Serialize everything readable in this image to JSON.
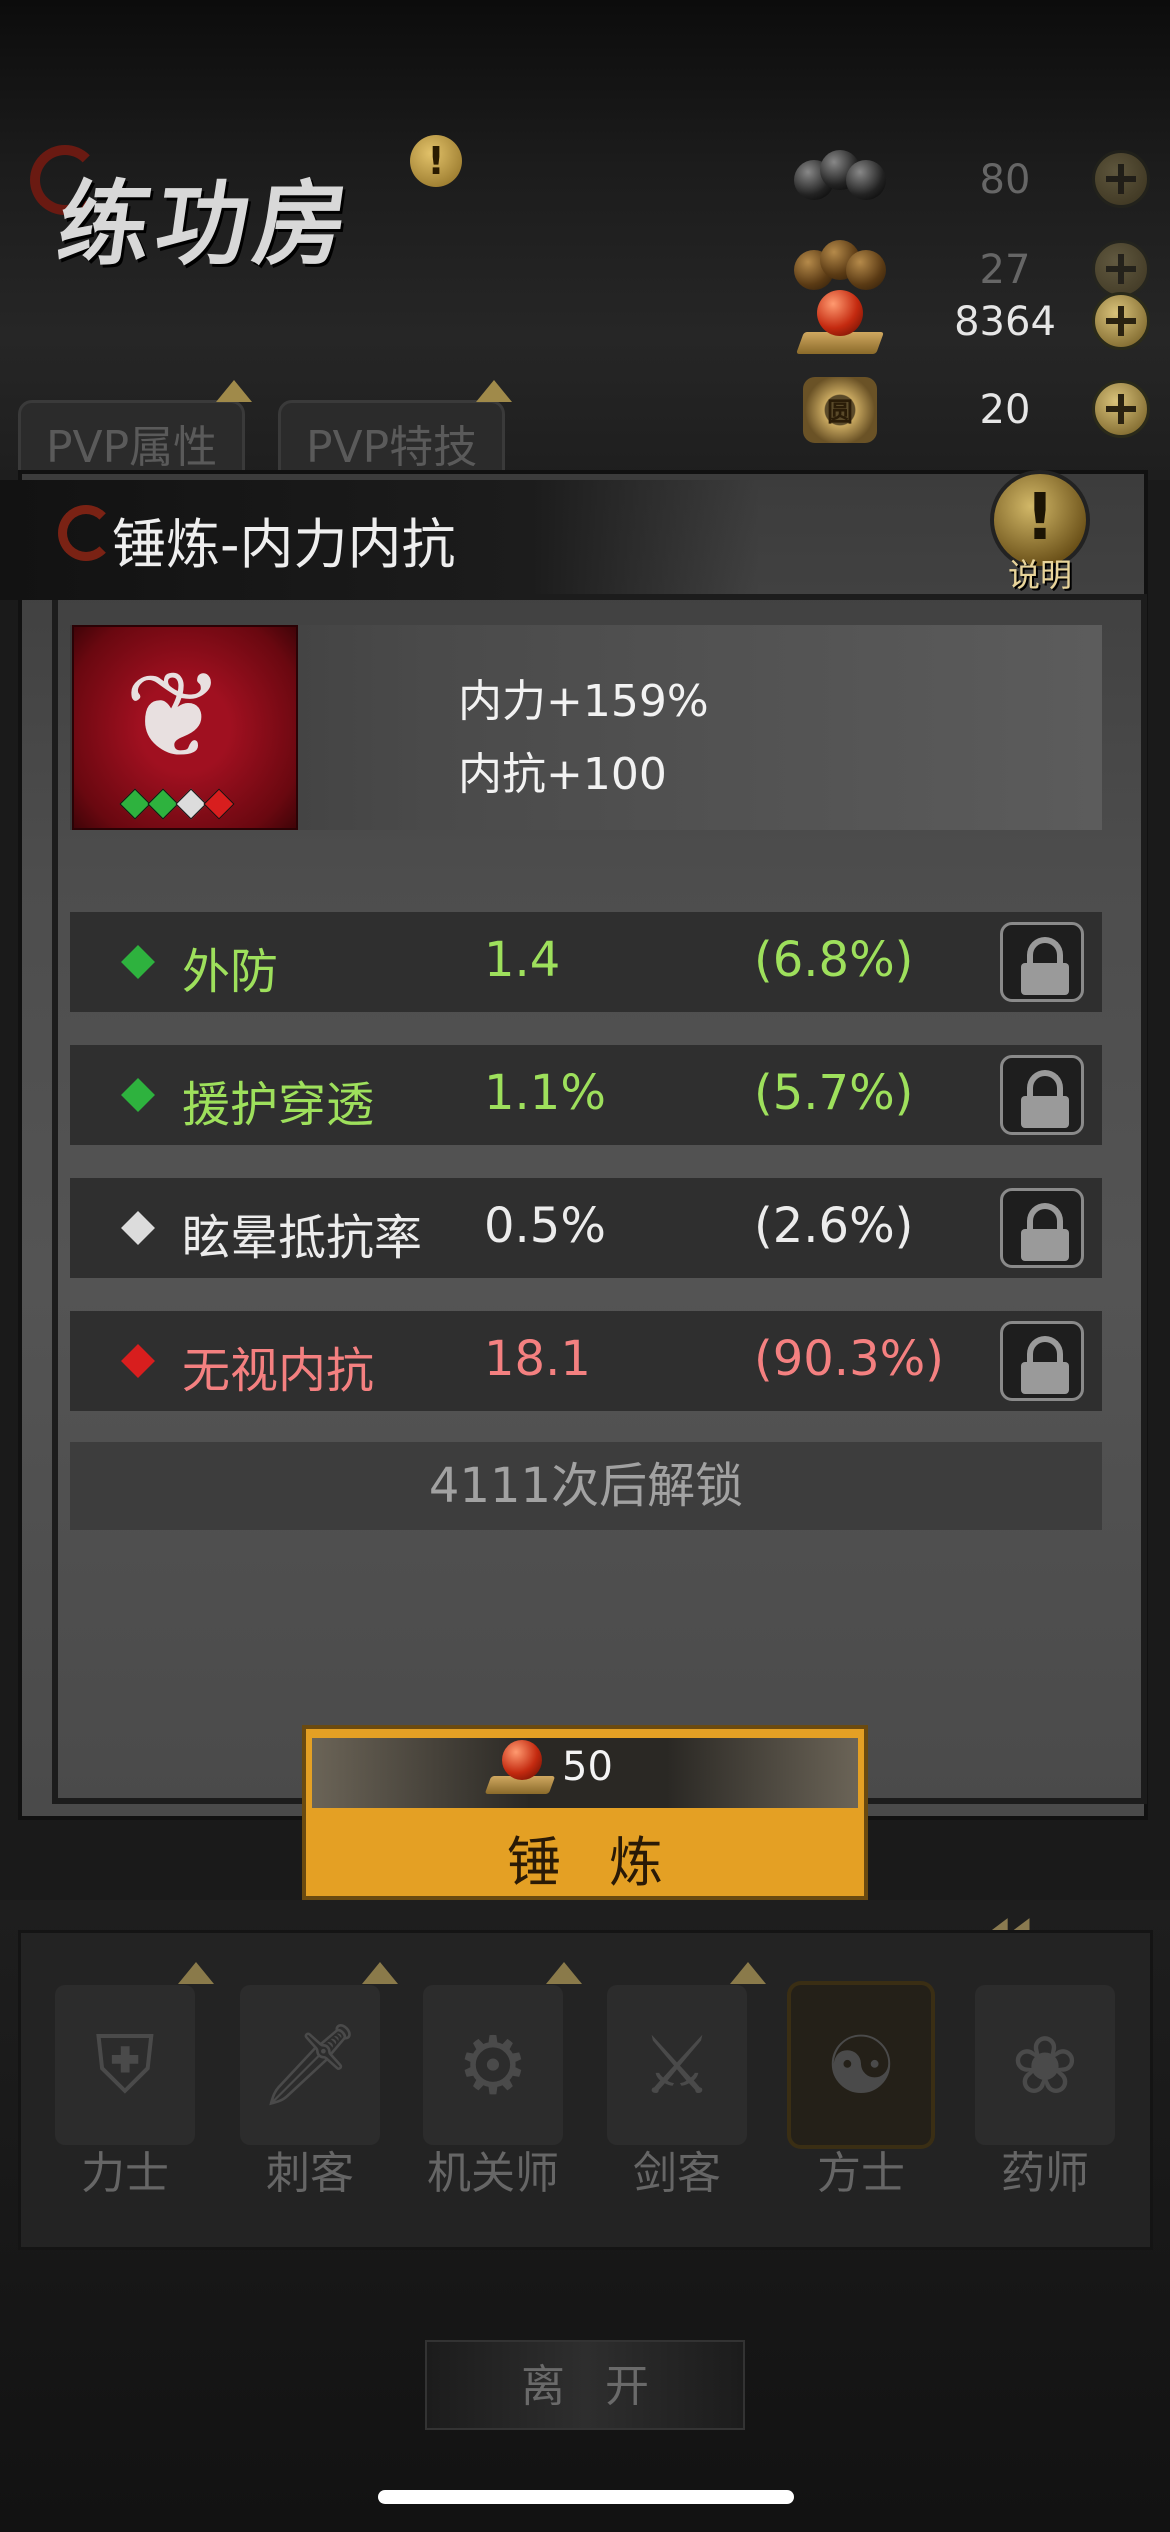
{
  "header": {
    "title": "练功房",
    "alert": "!"
  },
  "resources": [
    {
      "icon": "black-pellets-icon",
      "value": "80",
      "dim": true
    },
    {
      "icon": "brown-pellets-icon",
      "value": "27",
      "dim": true
    },
    {
      "icon": "red-pellet-icon",
      "value": "8364",
      "dim": false
    },
    {
      "icon": "coin-token-icon",
      "value": "20",
      "dim": false,
      "glyph": "圆"
    }
  ],
  "tabs": [
    {
      "label": "PVP属性"
    },
    {
      "label": "PVP特技"
    }
  ],
  "panel": {
    "title": "锤炼-内力内抗",
    "help_label": "说明",
    "help_glyph": "!"
  },
  "skill": {
    "line1": "内力+159%",
    "line2": "内抗+100"
  },
  "rows": [
    {
      "name": "外防",
      "value": "1.4",
      "pct": "(6.8%)",
      "quality": "green"
    },
    {
      "name": "援护穿透",
      "value": "1.1%",
      "pct": "(5.7%)",
      "quality": "green"
    },
    {
      "name": "眩晕抵抗率",
      "value": "0.5%",
      "pct": "(2.6%)",
      "quality": "white"
    },
    {
      "name": "无视内抗",
      "value": "18.1",
      "pct": "(90.3%)",
      "quality": "red"
    }
  ],
  "unlock_text": "4111次后解锁",
  "forge": {
    "cost": "50",
    "label": "锤炼"
  },
  "classes": [
    {
      "name": "力士",
      "active": false
    },
    {
      "name": "刺客",
      "active": false
    },
    {
      "name": "机关师",
      "active": false
    },
    {
      "name": "剑客",
      "active": false
    },
    {
      "name": "方士",
      "active": true
    },
    {
      "name": "药师",
      "active": false
    }
  ],
  "leave_label": "离开",
  "colors": {
    "green": "#9ee05c",
    "white": "#ececec",
    "red": "#f48080",
    "gem_green": "#2eb23e",
    "gem_white": "#dcdcdc",
    "gem_red": "#d81e1e",
    "forge_gold": "#e4a024"
  }
}
